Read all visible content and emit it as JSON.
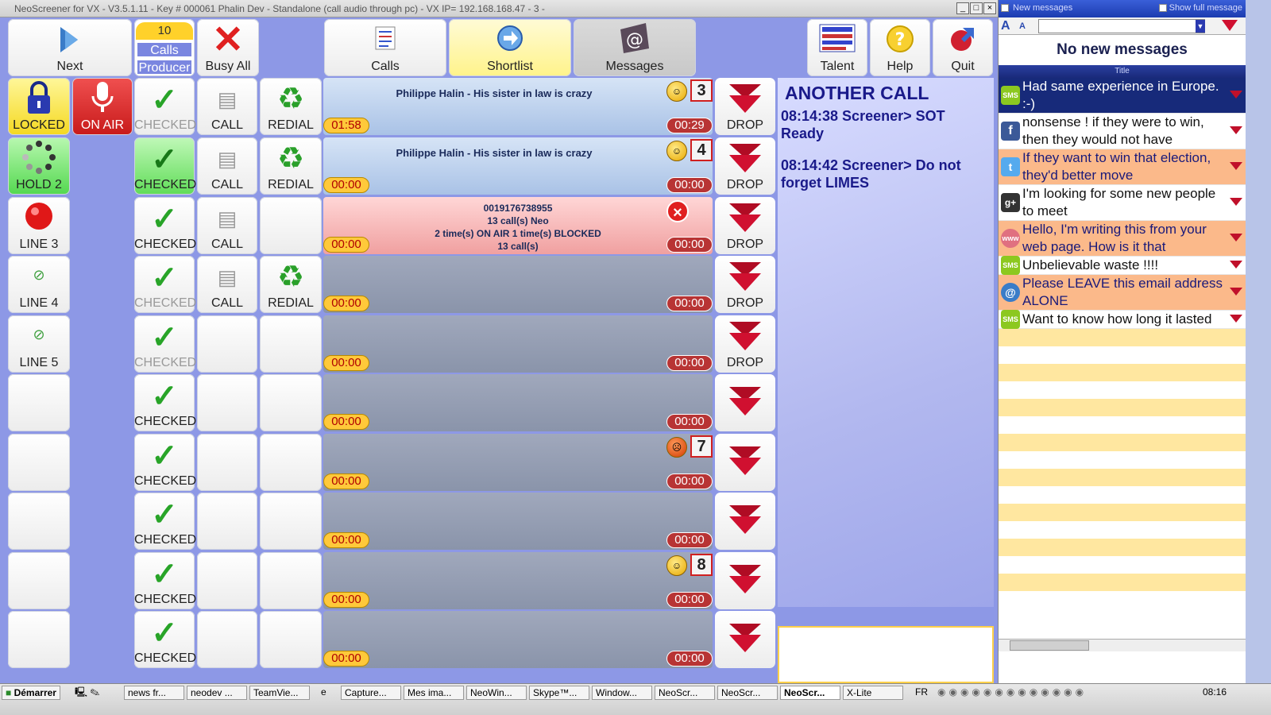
{
  "window": {
    "title": "NeoScreener for VX - V3.5.1.11 - Key # 000061 Phalin Dev - Standalone (call audio through pc) - VX IP= 192.168.168.47 - 3 -"
  },
  "toolbar": {
    "next": "Next",
    "calls_count": "10",
    "calls_label": "Calls",
    "producer_label": "Producer",
    "busy_all": "Busy All",
    "calls": "Calls",
    "shortlist": "Shortlist",
    "messages": "Messages",
    "talent": "Talent",
    "help": "Help",
    "quit": "Quit"
  },
  "lines": [
    {
      "label": "LOCKED"
    },
    {
      "label": "HOLD 2"
    },
    {
      "label": "LINE 3"
    },
    {
      "label": "LINE 4"
    },
    {
      "label": "LINE 5"
    }
  ],
  "on_air": "ON AIR",
  "checked": [
    "CHECKED",
    "CHECKED",
    "CHECKED",
    "CHECKED",
    "CHECKED",
    "CHECKED",
    "CHECKED",
    "CHECKED",
    "CHECKED",
    "CHECKED"
  ],
  "call_btns": [
    "CALL",
    "CALL",
    "CALL",
    "CALL"
  ],
  "redial_btns": [
    "REDIAL",
    "REDIAL",
    "REDIAL"
  ],
  "rows": [
    {
      "caller": "Philippe Halin - His sister in law is crazy",
      "num": "3",
      "t1": "01:58",
      "t2": "00:29",
      "drop": "DROP"
    },
    {
      "caller": "Philippe Halin - His sister in law is crazy",
      "num": "4",
      "t1": "00:00",
      "t2": "00:00",
      "drop": "DROP"
    },
    {
      "caller_lines": [
        "0019176738955",
        "13 call(s) Neo",
        "2 time(s) ON AIR 1 time(s) BLOCKED",
        "13 call(s)"
      ],
      "t1": "00:00",
      "t2": "00:00",
      "drop": "DROP"
    },
    {
      "t1": "00:00",
      "t2": "00:00",
      "drop": "DROP"
    },
    {
      "t1": "00:00",
      "t2": "00:00",
      "drop": "DROP"
    },
    {
      "t1": "00:00",
      "t2": "00:00"
    },
    {
      "num": "7",
      "t1": "00:00",
      "t2": "00:00"
    },
    {
      "t1": "00:00",
      "t2": "00:00"
    },
    {
      "num": "8",
      "t1": "00:00",
      "t2": "00:00"
    },
    {
      "t1": "00:00",
      "t2": "00:00"
    }
  ],
  "notes": {
    "heading": "ANOTHER CALL",
    "entries": [
      "08:14:38 Screener>  SOT Ready",
      "08:14:42 Screener>  Do not forget LIMES"
    ]
  },
  "messages_panel": {
    "titlebar": "New messages",
    "show_full": "Show full message",
    "header": "No new messages",
    "column": "Title",
    "items": [
      {
        "text": "Had same experience in Europe. :-)",
        "icon": "SMS"
      },
      {
        "text": "nonsense ! if they were to win, then they would not have",
        "icon": "f"
      },
      {
        "text": "If they want to win that election, they'd better move",
        "icon": "t"
      },
      {
        "text": "I'm looking for some new people to meet",
        "icon": "g+"
      },
      {
        "text": "Hello, I'm writing this from your web page. How is it that",
        "icon": "www"
      },
      {
        "text": "Unbelievable waste !!!!",
        "icon": "SMS"
      },
      {
        "text": "Please LEAVE this email address ALONE",
        "icon": "@"
      },
      {
        "text": "Want to know how long it lasted",
        "icon": "SMS"
      }
    ]
  },
  "taskbar": {
    "start": "Démarrer",
    "items": [
      "news fr...",
      "neodev ...",
      "TeamVie...",
      "Capture...",
      "Mes ima...",
      "NeoWin...",
      "Skype™...",
      "Window...",
      "NeoScr...",
      "NeoScr...",
      "NeoScr...",
      "X-Lite"
    ],
    "lang": "FR",
    "clock": "08:16"
  },
  "colors": {
    "accent": "#8d98e6",
    "timer_yellow": "#ffc93a",
    "timer_red": "#b83434",
    "drop_red": "#c0102a"
  }
}
